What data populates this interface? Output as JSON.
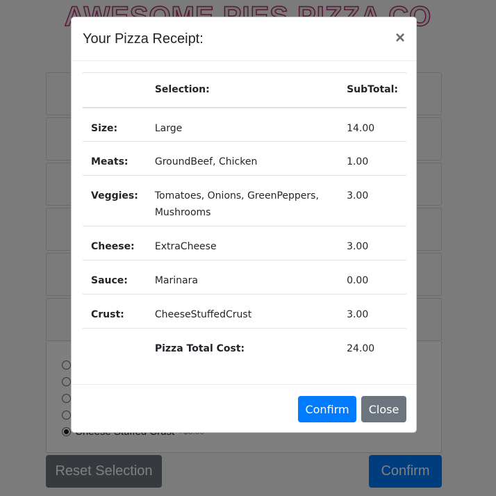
{
  "page": {
    "title": "AWESOME PIES PIZZA CO",
    "reset_label": "Reset Selection",
    "confirm_label": "Confirm",
    "crust_options": [
      {
        "label": "",
        "price": "",
        "checked": false
      },
      {
        "label": "",
        "price": "",
        "checked": false
      },
      {
        "label": "",
        "price": "",
        "checked": false
      },
      {
        "label": "",
        "price": "",
        "checked": false
      },
      {
        "label": "Cheese Stuffed Crust",
        "price": "+$3.00",
        "checked": true
      }
    ]
  },
  "modal": {
    "title": "Your Pizza Receipt:",
    "close_symbol": "×",
    "table": {
      "headers": {
        "category": "",
        "selection": "Selection:",
        "subtotal": "SubTotal:"
      },
      "rows": [
        {
          "label": "Size:",
          "selection": "Large",
          "subtotal": "14.00"
        },
        {
          "label": "Meats:",
          "selection": "GroundBeef, Chicken",
          "subtotal": "1.00"
        },
        {
          "label": "Veggies:",
          "selection": "Tomatoes, Onions, GreenPeppers, Mushrooms",
          "subtotal": "3.00"
        },
        {
          "label": "Cheese:",
          "selection": "ExtraCheese",
          "subtotal": "3.00"
        },
        {
          "label": "Sauce:",
          "selection": "Marinara",
          "subtotal": "0.00"
        },
        {
          "label": "Crust:",
          "selection": "CheeseStuffedCrust",
          "subtotal": "3.00"
        }
      ],
      "total": {
        "label": "Pizza Total Cost:",
        "value": "24.00"
      }
    },
    "footer": {
      "confirm_label": "Confirm",
      "close_label": "Close"
    }
  },
  "colors": {
    "primary": "#007bff",
    "secondary": "#6c757d",
    "title_stroke": "#b32d6e"
  }
}
